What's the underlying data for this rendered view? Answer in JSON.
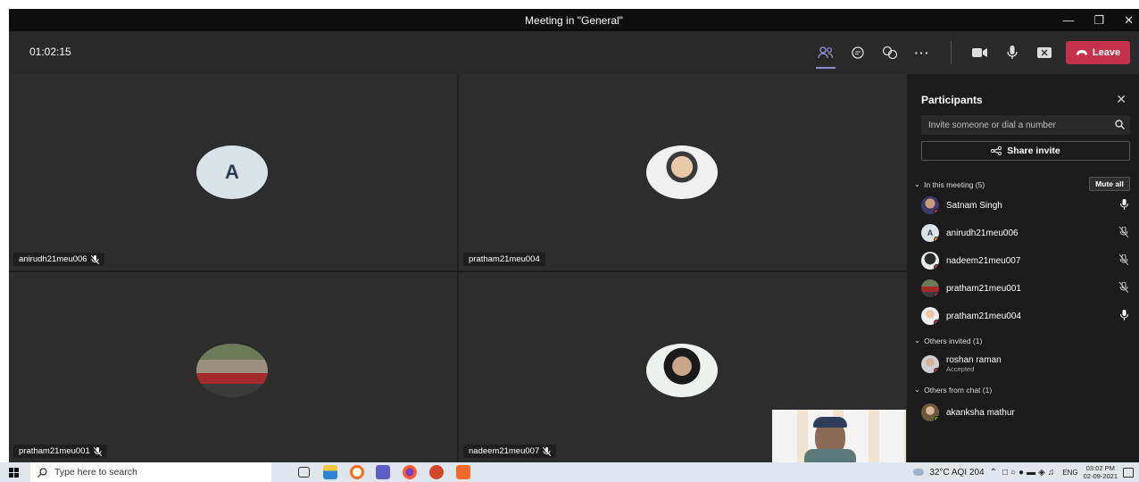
{
  "window": {
    "title": "Meeting in \"General\""
  },
  "toolbar": {
    "timer": "01:02:15",
    "leave_label": "Leave"
  },
  "tiles": [
    {
      "name": "anirudh21meu006",
      "initial": "A",
      "muted": true
    },
    {
      "name": "pratham21meu004",
      "muted": false
    },
    {
      "name": "pratham21meu001",
      "muted": true
    },
    {
      "name": "nadeem21meu007",
      "muted": true
    }
  ],
  "panel": {
    "title": "Participants",
    "invite_placeholder": "Invite someone or dial a number",
    "share_label": "Share invite",
    "section_meeting": "In this meeting (5)",
    "mute_all": "Mute all",
    "participants": [
      {
        "name": "Satnam Singh",
        "mic": "on",
        "status_color": "#c4314b"
      },
      {
        "name": "anirudh21meu006",
        "mic": "off",
        "status_color": "#f8a800",
        "initial": "A"
      },
      {
        "name": "nadeem21meu007",
        "mic": "off",
        "status_color": "#c4314b"
      },
      {
        "name": "pratham21meu001",
        "mic": "off",
        "status_color": "#c4314b"
      },
      {
        "name": "pratham21meu004",
        "mic": "on",
        "status_color": "#c4314b"
      }
    ],
    "section_invited": "Others invited (1)",
    "invited": [
      {
        "name": "roshan raman",
        "status": "Accepted"
      }
    ],
    "section_chat": "Others from chat (1)",
    "chat": [
      {
        "name": "akanksha mathur"
      }
    ]
  },
  "taskbar": {
    "search_placeholder": "Type here to search",
    "weather": "32°C AQI 204",
    "lang": "ENG",
    "time": "03:02 PM",
    "date": "02-09-2021"
  }
}
